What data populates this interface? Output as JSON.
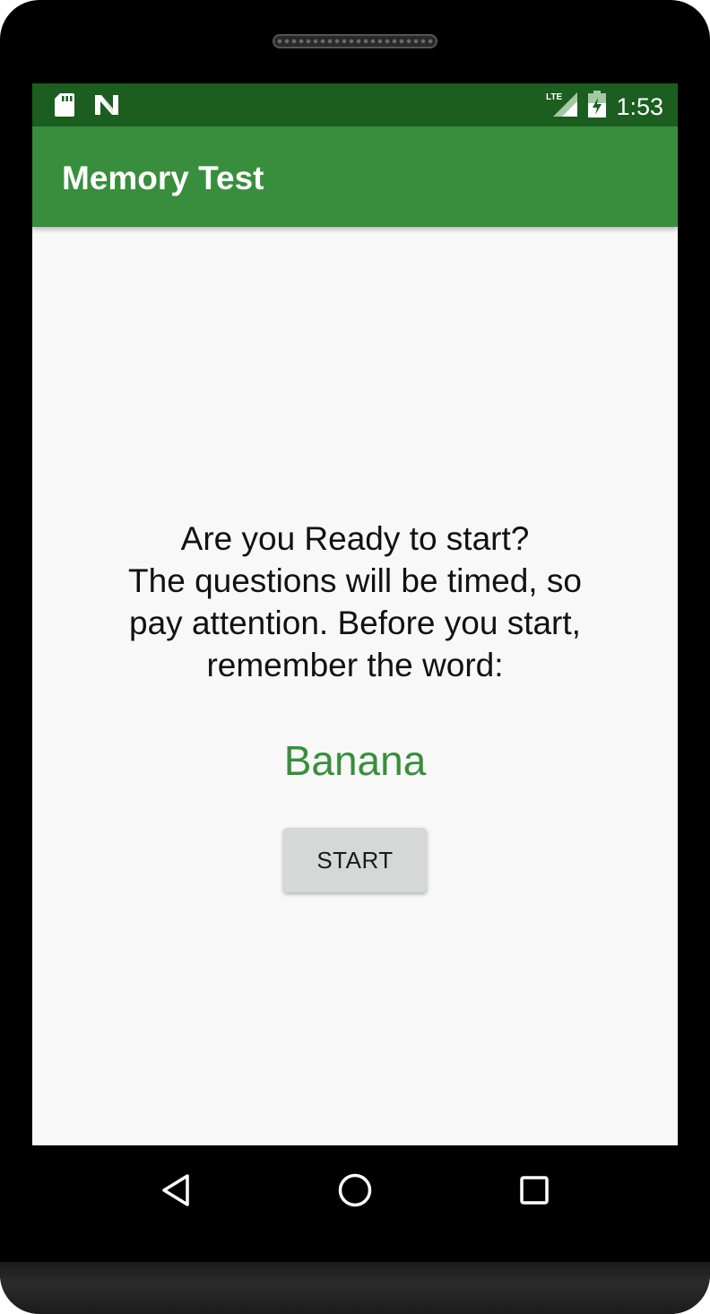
{
  "status_bar": {
    "time": "1:53",
    "icons": [
      "sd-card-icon",
      "n-notification-icon",
      "lte-signal-icon",
      "battery-charging-icon"
    ],
    "network_label": "LTE",
    "color": "#1b5e20"
  },
  "app_bar": {
    "title": "Memory Test",
    "color": "#388e3c"
  },
  "main": {
    "prompt_lines": [
      "Are you Ready to start?",
      "The questions will be timed, so",
      "pay attention. Before you start,",
      "remember the word:"
    ],
    "word": "Banana",
    "word_color": "#388e3c",
    "start_label": "START"
  },
  "nav_bar": {
    "buttons": [
      "back-icon",
      "home-icon",
      "recents-icon"
    ]
  }
}
